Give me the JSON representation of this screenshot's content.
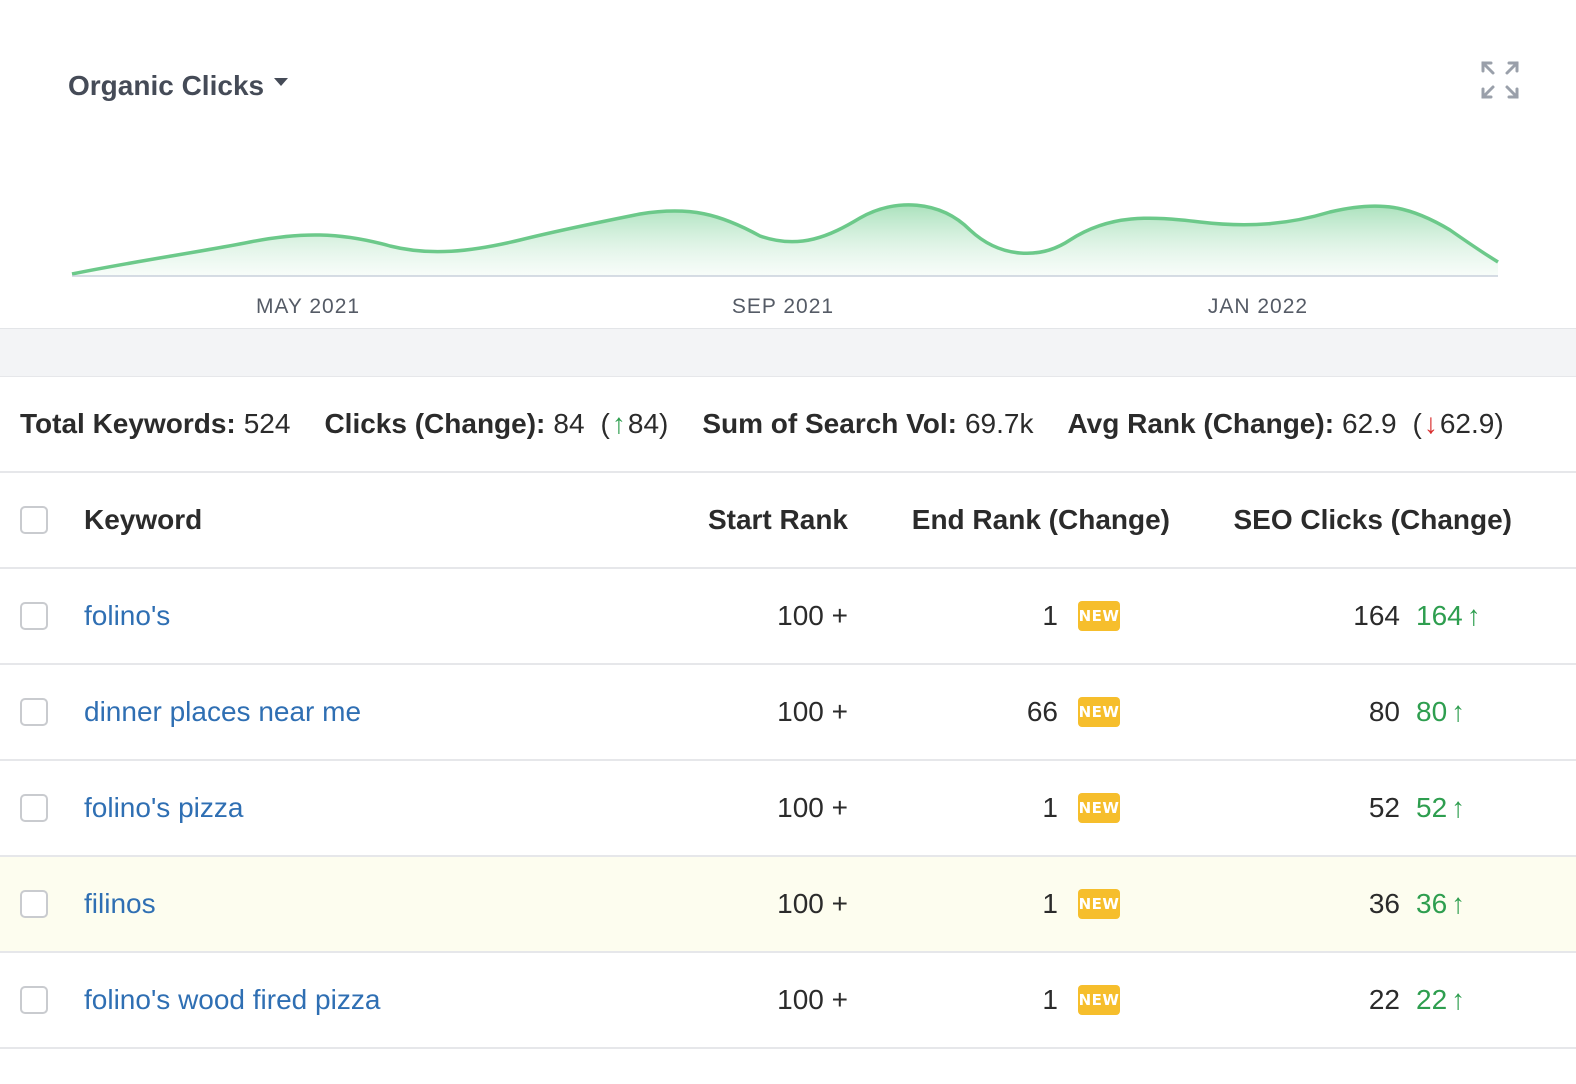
{
  "chart": {
    "title": "Organic Clicks",
    "expand_icon": "expand-icon",
    "color": "#6cc98a",
    "ticks": [
      "MAY 2021",
      "SEP 2021",
      "JAN 2022"
    ]
  },
  "summary": {
    "total_keywords_label": "Total Keywords:",
    "total_keywords_value": "524",
    "clicks_label": "Clicks (Change):",
    "clicks_value": "84",
    "clicks_change_open": "(",
    "clicks_change_arrow": "↑",
    "clicks_change": "84)",
    "search_vol_label": "Sum of Search Vol:",
    "search_vol_value": "69.7k",
    "avg_rank_label": "Avg Rank (Change):",
    "avg_rank_value": "62.9",
    "avg_rank_change_open": "(",
    "avg_rank_change_arrow": "↓",
    "avg_rank_change": "62.9)"
  },
  "table": {
    "headers": {
      "keyword": "Keyword",
      "start_rank": "Start Rank",
      "end_rank": "End Rank (Change)",
      "seo_clicks": "SEO Clicks (Change)"
    },
    "rows": [
      {
        "keyword": "folino's",
        "start_rank": "100 +",
        "end_rank": "1",
        "badge": "NEW",
        "clicks": "164",
        "clicks_change": "164",
        "arrow": "↑"
      },
      {
        "keyword": "dinner places near me",
        "start_rank": "100 +",
        "end_rank": "66",
        "badge": "NEW",
        "clicks": "80",
        "clicks_change": "80",
        "arrow": "↑"
      },
      {
        "keyword": "folino's pizza",
        "start_rank": "100 +",
        "end_rank": "1",
        "badge": "NEW",
        "clicks": "52",
        "clicks_change": "52",
        "arrow": "↑"
      },
      {
        "keyword": "filinos",
        "start_rank": "100 +",
        "end_rank": "1",
        "badge": "NEW",
        "clicks": "36",
        "clicks_change": "36",
        "arrow": "↑"
      },
      {
        "keyword": "folino's wood fired pizza",
        "start_rank": "100 +",
        "end_rank": "1",
        "badge": "NEW",
        "clicks": "22",
        "clicks_change": "22",
        "arrow": "↑"
      }
    ]
  }
}
